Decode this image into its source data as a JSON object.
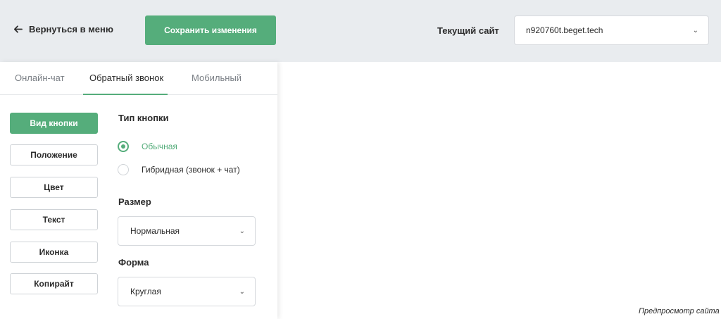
{
  "header": {
    "back_label": "Вернуться в меню",
    "save_label": "Сохранить изменения",
    "site_label": "Текущий сайт",
    "site_value": "n920760t.beget.tech"
  },
  "tabs": [
    {
      "label": "Онлайн-чат",
      "active": false
    },
    {
      "label": "Обратный звонок",
      "active": true
    },
    {
      "label": "Мобильный",
      "active": false
    }
  ],
  "side_menu": [
    {
      "label": "Вид кнопки",
      "active": true
    },
    {
      "label": "Положение",
      "active": false
    },
    {
      "label": "Цвет",
      "active": false
    },
    {
      "label": "Текст",
      "active": false
    },
    {
      "label": "Иконка",
      "active": false
    },
    {
      "label": "Копирайт",
      "active": false
    }
  ],
  "button_type": {
    "title": "Тип кнопки",
    "options": [
      {
        "label": "Обычная",
        "selected": true
      },
      {
        "label": "Гибридная (звонок + чат)",
        "selected": false
      }
    ]
  },
  "size": {
    "title": "Размер",
    "value": "Нормальная"
  },
  "shape": {
    "title": "Форма",
    "value": "Круглая"
  },
  "preview_note": "Предпросмотр сайта ,",
  "colors": {
    "accent": "#55ad7b",
    "topbar": "#e9ecef"
  }
}
